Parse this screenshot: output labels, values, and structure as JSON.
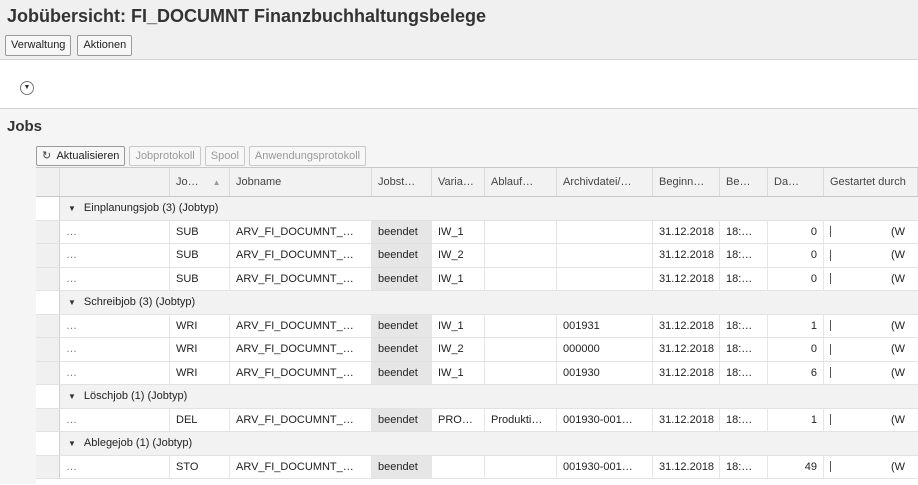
{
  "page": {
    "title": "Jobübersicht: FI_DOCUMNT Finanzbuchhaltungsbelege"
  },
  "menu": {
    "verwaltung": "Verwaltung",
    "aktionen": "Aktionen"
  },
  "expand_icon": "chevron-down-circle-icon",
  "jobs": {
    "title": "Jobs",
    "toolbar": {
      "refresh": "Aktualisieren",
      "jobprotokoll": "Jobprotokoll",
      "spool": "Spool",
      "anwendungsprotokoll": "Anwendungsprotokoll"
    },
    "columns": {
      "jo": "Jo…",
      "jobname": "Jobname",
      "jobstatus": "Jobst…",
      "variante": "Varia…",
      "ablauf": "Ablauf…",
      "archivdatei": "Archivdatei/…",
      "beginn": "Beginn…",
      "be": "Be…",
      "da": "Da…",
      "gestartet": "Gestartet durch"
    },
    "groups": [
      {
        "label": "Einplanungsjob (3) (Jobtyp)",
        "rows": [
          {
            "dots": "…",
            "jo": "SUB",
            "jobname": "ARV_FI_DOCUMNT_…",
            "status": "beendet",
            "variant": "IW_1",
            "ablauf": "",
            "archiv": "",
            "beginn": "31.12.2018",
            "be": "18:…",
            "da": "0",
            "started": "(W"
          },
          {
            "dots": "…",
            "jo": "SUB",
            "jobname": "ARV_FI_DOCUMNT_…",
            "status": "beendet",
            "variant": "IW_2",
            "ablauf": "",
            "archiv": "",
            "beginn": "31.12.2018",
            "be": "18:…",
            "da": "0",
            "started": "(W"
          },
          {
            "dots": "…",
            "jo": "SUB",
            "jobname": "ARV_FI_DOCUMNT_…",
            "status": "beendet",
            "variant": "IW_1",
            "ablauf": "",
            "archiv": "",
            "beginn": "31.12.2018",
            "be": "18:…",
            "da": "0",
            "started": "(W"
          }
        ]
      },
      {
        "label": "Schreibjob (3) (Jobtyp)",
        "rows": [
          {
            "dots": "…",
            "jo": "WRI",
            "jobname": "ARV_FI_DOCUMNT_…",
            "status": "beendet",
            "variant": "IW_1",
            "ablauf": "",
            "archiv": "001931",
            "beginn": "31.12.2018",
            "be": "18:…",
            "da": "1",
            "started": "(W"
          },
          {
            "dots": "…",
            "jo": "WRI",
            "jobname": "ARV_FI_DOCUMNT_…",
            "status": "beendet",
            "variant": "IW_2",
            "ablauf": "",
            "archiv": "000000",
            "beginn": "31.12.2018",
            "be": "18:…",
            "da": "0",
            "started": "(W"
          },
          {
            "dots": "…",
            "jo": "WRI",
            "jobname": "ARV_FI_DOCUMNT_…",
            "status": "beendet",
            "variant": "IW_1",
            "ablauf": "",
            "archiv": "001930",
            "beginn": "31.12.2018",
            "be": "18:…",
            "da": "6",
            "started": "(W"
          }
        ]
      },
      {
        "label": "Löschjob (1) (Jobtyp)",
        "rows": [
          {
            "dots": "…",
            "jo": "DEL",
            "jobname": "ARV_FI_DOCUMNT_…",
            "status": "beendet",
            "variant": "PRO…",
            "ablauf": "Produkti…",
            "archiv": "001930-001…",
            "beginn": "31.12.2018",
            "be": "18:…",
            "da": "1",
            "started": "(W"
          }
        ]
      },
      {
        "label": "Ablegejob (1) (Jobtyp)",
        "rows": [
          {
            "dots": "…",
            "jo": "STO",
            "jobname": "ARV_FI_DOCUMNT_…",
            "status": "beendet",
            "variant": "",
            "ablauf": "",
            "archiv": "001930-001…",
            "beginn": "31.12.2018",
            "be": "18:…",
            "da": "49",
            "started": "(W"
          }
        ]
      }
    ]
  }
}
